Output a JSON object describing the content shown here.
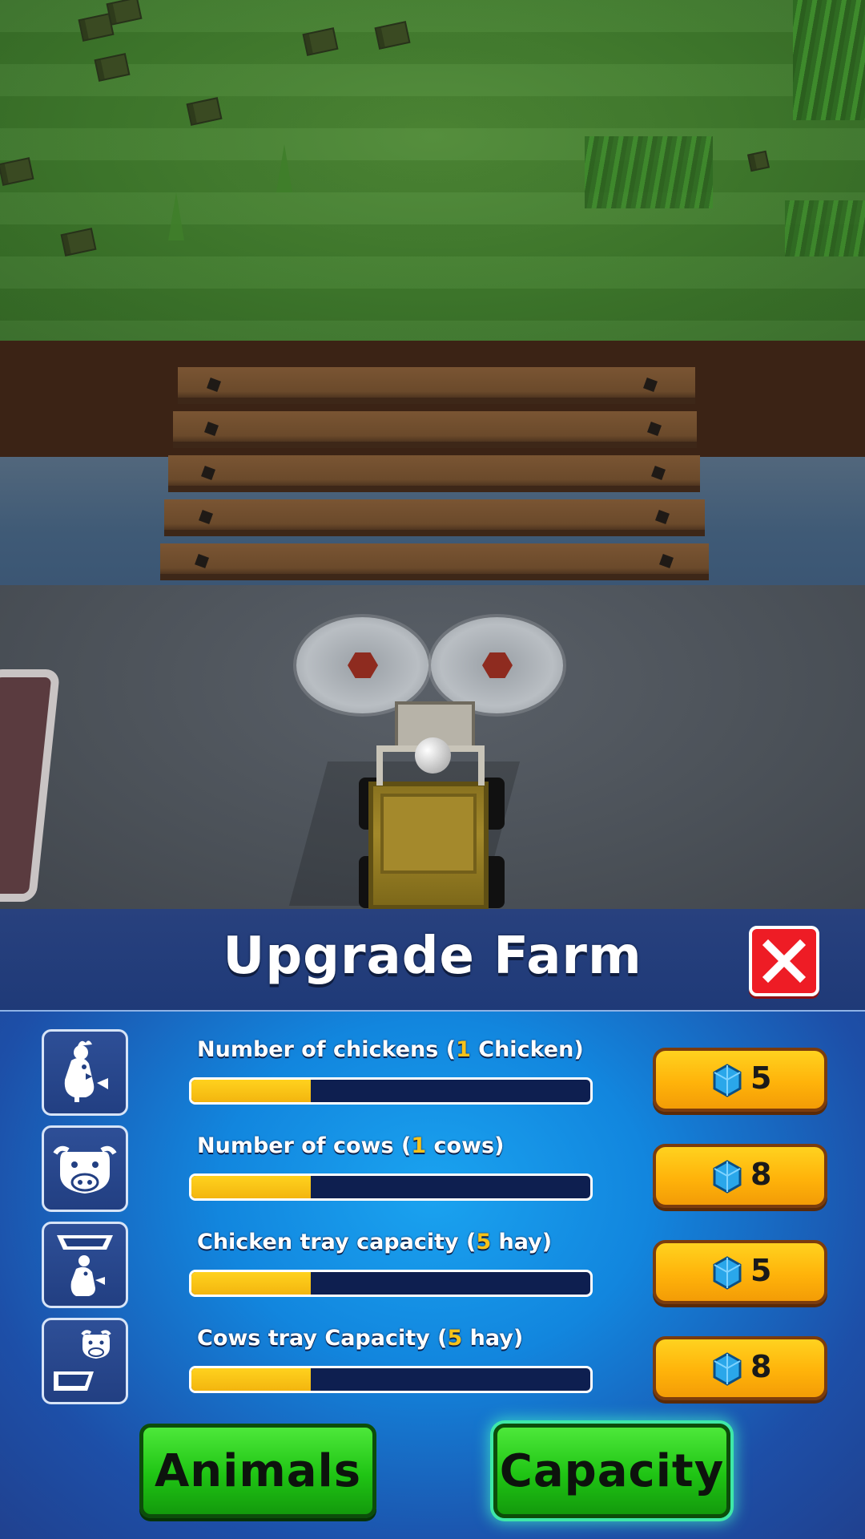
{
  "panel": {
    "title": "Upgrade Farm",
    "close_icon": "close-icon"
  },
  "upgrades": [
    {
      "icon": "chicken-icon",
      "label_prefix": "Number of chickens (",
      "value": "1",
      "label_suffix": " Chicken)",
      "progress": 0.3,
      "price": "5",
      "currency_icon": "gem-icon"
    },
    {
      "icon": "cow-icon",
      "label_prefix": "Number of cows (",
      "value": "1",
      "label_suffix": " cows)",
      "progress": 0.3,
      "price": "8",
      "currency_icon": "gem-icon"
    },
    {
      "icon": "chicken-tray-icon",
      "label_prefix": "Chicken tray capacity (",
      "value": "5",
      "label_suffix": " hay)",
      "progress": 0.3,
      "price": "5",
      "currency_icon": "gem-icon"
    },
    {
      "icon": "cow-tray-icon",
      "label_prefix": "Cows tray  Capacity (",
      "value": "5",
      "label_suffix": " hay)",
      "progress": 0.3,
      "price": "8",
      "currency_icon": "gem-icon"
    }
  ],
  "tabs": [
    {
      "label": "Animals",
      "active": false
    },
    {
      "label": "Capacity",
      "active": true
    }
  ],
  "colors": {
    "panel_blue": "#1286de",
    "header_blue": "#1f3a78",
    "progress_fill": "#f6c21a",
    "price_button": "#ffb30a",
    "tab_green": "#1fc414",
    "close_red": "#ee1c25"
  }
}
